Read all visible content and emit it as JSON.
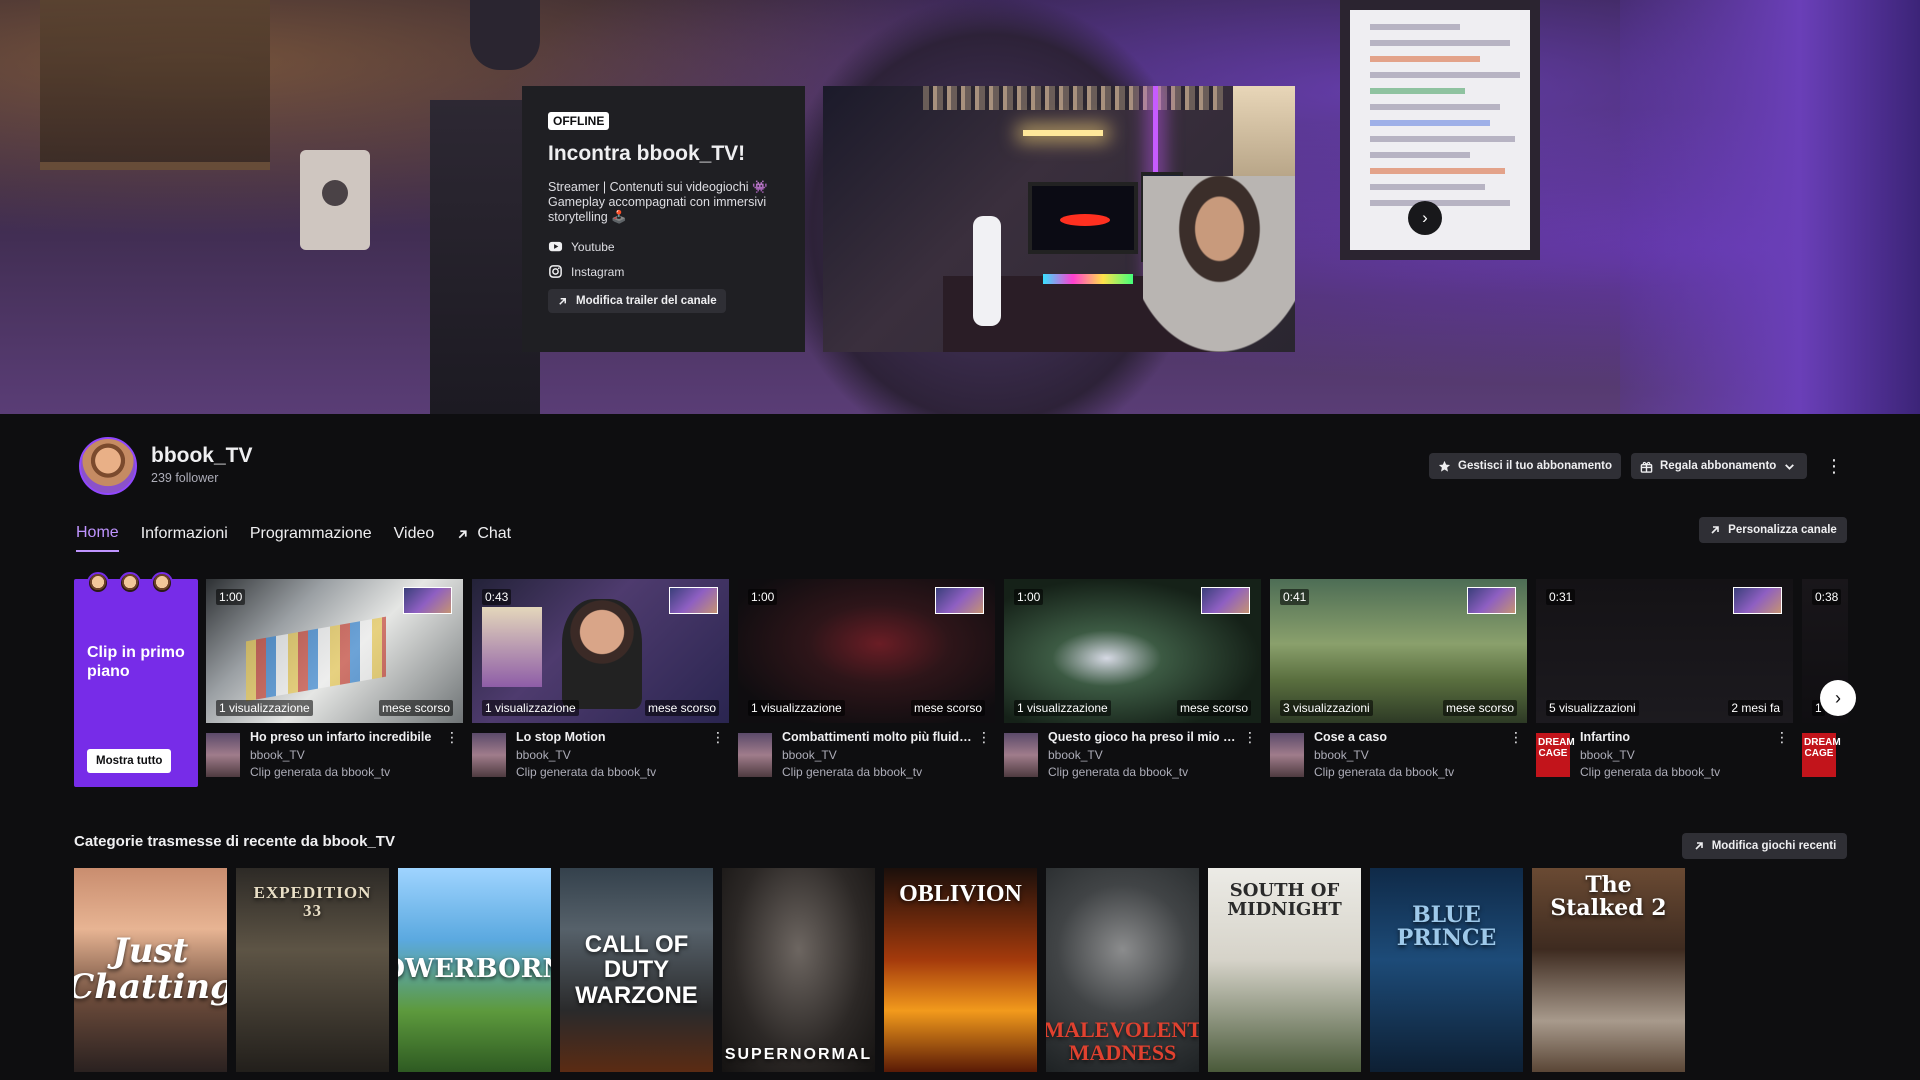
{
  "colors": {
    "accent": "#9147ff",
    "accent_light": "#bf94ff",
    "featured_bg": "#772ce8",
    "background": "#0e0e10",
    "button_bg": "#2f2f35"
  },
  "banner": {
    "offline_badge": "OFFLINE",
    "card_title": "Incontra bbook_TV!",
    "card_description": "Streamer | Contenuti sui videogiochi 👾 Gameplay accompagnati con immersivi storytelling 🕹️",
    "socials": [
      {
        "label": "Youtube",
        "icon": "youtube-icon"
      },
      {
        "label": "Instagram",
        "icon": "instagram-icon"
      }
    ],
    "edit_trailer_label": "Modifica trailer del canale",
    "next_icon": "chevron-right-icon"
  },
  "channel": {
    "name": "bbook_TV",
    "followers": "239 follower",
    "manage_sub_label": "Gestisci il tuo abbonamento",
    "gift_sub_label": "Regala abbonamento"
  },
  "tabs": [
    {
      "label": "Home",
      "active": true
    },
    {
      "label": "Informazioni"
    },
    {
      "label": "Programmazione"
    },
    {
      "label": "Video"
    },
    {
      "label": "Chat",
      "icon": "external-arrow-icon"
    }
  ],
  "personalize_label": "Personalizza canale",
  "featured": {
    "title": "Clip in primo piano",
    "button": "Mostra tutto"
  },
  "clips": [
    {
      "duration": "1:00",
      "views": "1 visualizzazione",
      "age": "mese scorso",
      "title": "Ho preso un infarto incredibile",
      "channel": "bbook_TV",
      "credit": "Clip generata da bbook_tv"
    },
    {
      "duration": "0:43",
      "views": "1 visualizzazione",
      "age": "mese scorso",
      "title": "Lo stop Motion",
      "channel": "bbook_TV",
      "credit": "Clip generata da bbook_tv"
    },
    {
      "duration": "1:00",
      "views": "1 visualizzazione",
      "age": "mese scorso",
      "title": "Combattimenti molto più fluidi...",
      "channel": "bbook_TV",
      "credit": "Clip generata da bbook_tv"
    },
    {
      "duration": "1:00",
      "views": "1 visualizzazione",
      "age": "mese scorso",
      "title": "Questo gioco ha preso il mio c...",
      "channel": "bbook_TV",
      "credit": "Clip generata da bbook_tv"
    },
    {
      "duration": "0:41",
      "views": "3 visualizzazioni",
      "age": "mese scorso",
      "title": "Cose a caso",
      "channel": "bbook_TV",
      "credit": "Clip generata da bbook_tv"
    },
    {
      "duration": "0:31",
      "views": "5 visualizzazioni",
      "age": "2 mesi fa",
      "title": "Infartino",
      "channel": "bbook_TV",
      "credit": "Clip generata da bbook_tv"
    },
    {
      "duration": "0:38",
      "views": "1",
      "age": "",
      "title": "",
      "channel": "",
      "credit": ""
    }
  ],
  "categories": {
    "title": "Categorie trasmesse di recente da bbook_TV",
    "edit_label": "Modifica giochi recenti",
    "covers": [
      {
        "name": "Just Chatting"
      },
      {
        "name": "EXPEDITION 33"
      },
      {
        "name": "TOWERBORNE"
      },
      {
        "name": "CALL OF DUTY WARZONE"
      },
      {
        "name": "SUPERNORMAL"
      },
      {
        "name": "OBLIVION"
      },
      {
        "name": "MALEVOLENT MADNESS"
      },
      {
        "name": "SOUTH OF MIDNIGHT"
      },
      {
        "name": "BLUE PRINCE"
      },
      {
        "name": "The Stalked 2"
      }
    ]
  }
}
